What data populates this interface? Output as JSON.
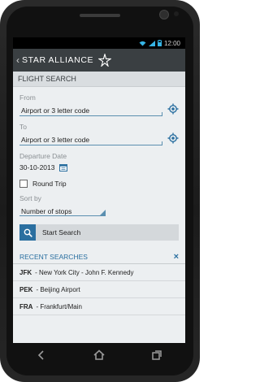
{
  "status": {
    "time": "12:00"
  },
  "header": {
    "title": "STAR ALLIANCE"
  },
  "section": {
    "title": "FLIGHT SEARCH"
  },
  "form": {
    "from_label": "From",
    "from_value": "Airport or 3 letter code",
    "to_label": "To",
    "to_value": "Airport or 3 letter code",
    "date_label": "Departure Date",
    "date_value": "30-10-2013",
    "round_trip_label": "Round Trip",
    "sort_label": "Sort by",
    "sort_value": "Number of stops",
    "search_label": "Start Search"
  },
  "recent": {
    "title": "RECENT SEARCHES",
    "items": [
      {
        "code": "JFK",
        "desc": "- New York City - John F. Kennedy"
      },
      {
        "code": "PEK",
        "desc": "- Beijing Airport"
      },
      {
        "code": "FRA",
        "desc": "- Frankfurt/Main"
      }
    ]
  },
  "colors": {
    "accent": "#2a6fa0",
    "appbar": "#3a3f42",
    "underline": "#5b8fb0"
  }
}
